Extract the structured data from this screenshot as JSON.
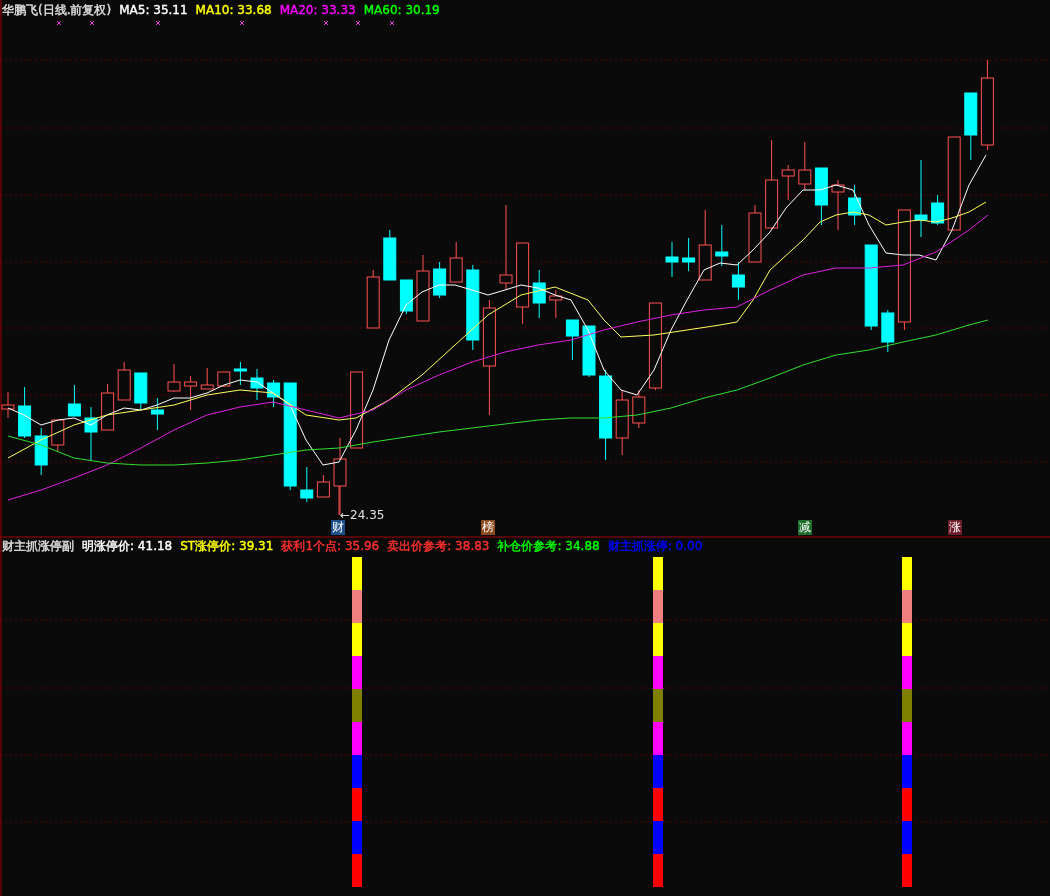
{
  "title_bar": {
    "name": "华鹏飞(日线.前复权)",
    "indicators": [
      {
        "label": "MA5: 35.11",
        "color": "#ffffff"
      },
      {
        "label": "MA10: 33.68",
        "color": "#ffff00"
      },
      {
        "label": "MA20: 33.33",
        "color": "#ff00ff"
      },
      {
        "label": "MA60: 30.19",
        "color": "#00ff00"
      }
    ]
  },
  "price_panel": {
    "low_marker": "←24.35",
    "signals": [
      {
        "label": "财",
        "color": "#1d4f8a"
      },
      {
        "label": "榜",
        "color": "#8a4a1d"
      },
      {
        "label": "减",
        "color": "#1d6e2a"
      },
      {
        "label": "涨",
        "color": "#6e1d2a"
      }
    ]
  },
  "indicator_panel": {
    "name": "财主抓涨停副",
    "values": [
      {
        "label": "明涨停价: 41.18",
        "color": "#ffffff"
      },
      {
        "label": "ST涨停价: 39.31",
        "color": "#ffff00"
      },
      {
        "label": "获利1个点: 35.96",
        "color": "#ff3030"
      },
      {
        "label": "卖出价参考: 38.83",
        "color": "#ff3030"
      },
      {
        "label": "补仓价参考: 34.88",
        "color": "#00ff00"
      },
      {
        "label": "财主抓涨停: 0.00",
        "color": "#0000ff"
      }
    ]
  }
}
